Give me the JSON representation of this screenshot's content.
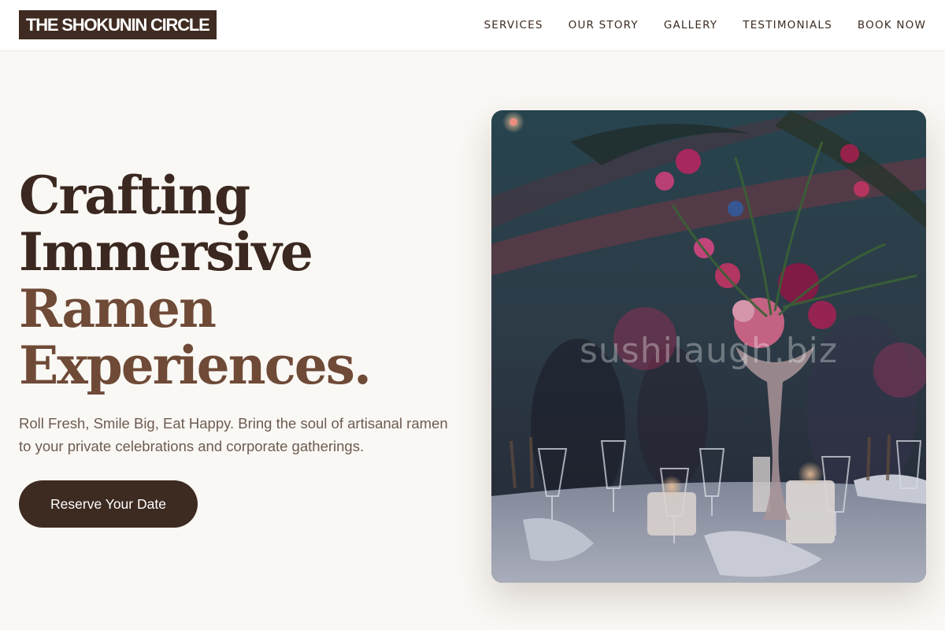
{
  "brand": {
    "logo_text": "THE SHOKUNIN CIRCLE"
  },
  "nav": {
    "links": [
      {
        "label": "SERVICES"
      },
      {
        "label": "OUR STORY"
      },
      {
        "label": "GALLERY"
      },
      {
        "label": "TESTIMONIALS"
      },
      {
        "label": "BOOK NOW"
      }
    ]
  },
  "hero": {
    "title_lines": [
      "Crafting",
      "Immersive",
      "Ramen",
      "Experiences."
    ],
    "subtitle": "Roll Fresh, Smile Big, Eat Happy. Bring the soul of artisanal ramen to your private celebrations and corporate gatherings.",
    "cta_label": "Reserve Your Date",
    "image_watermark": "sushilaugh.biz"
  },
  "colors": {
    "background": "#faf8f4",
    "brand_dark": "#3f2b21",
    "accent_brown": "#6e4a37",
    "text_muted": "#6d5b52"
  }
}
